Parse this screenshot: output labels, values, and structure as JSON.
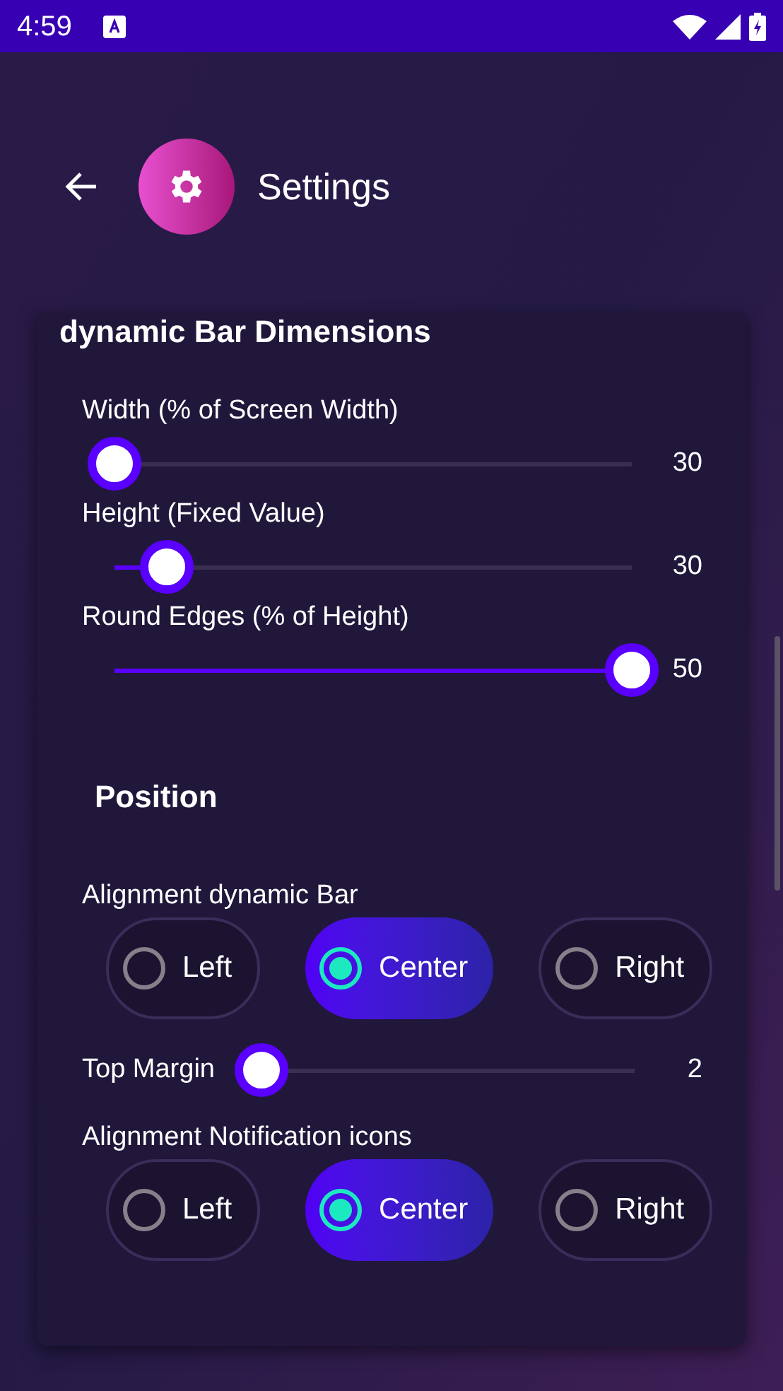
{
  "status_bar": {
    "time": "4:59"
  },
  "header": {
    "title": "Settings"
  },
  "dimensions": {
    "title": "dynamic Bar Dimensions",
    "sliders": [
      {
        "label": "Width (% of Screen Width)",
        "level": 0,
        "reading": "30"
      },
      {
        "label": "Height (Fixed Value)",
        "level": 0.1,
        "reading": "30"
      },
      {
        "label": "Round Edges (% of Height)",
        "level": 1,
        "reading": "50"
      }
    ]
  },
  "position": {
    "title": "Position",
    "items": [
      {
        "kind": "radio_group",
        "label": "Alignment dynamic Bar",
        "options": [
          {
            "label": "Left",
            "selected": false
          },
          {
            "label": "Center",
            "selected": true
          },
          {
            "label": "Right",
            "selected": false
          }
        ]
      },
      {
        "kind": "slider",
        "label": "Top Margin",
        "level": 0,
        "reading": "2"
      },
      {
        "kind": "radio_group",
        "label": "Alignment Notification icons",
        "options": [
          {
            "label": "Left",
            "selected": false
          },
          {
            "label": "Center",
            "selected": true
          },
          {
            "label": "Right",
            "selected": false
          }
        ]
      }
    ]
  }
}
